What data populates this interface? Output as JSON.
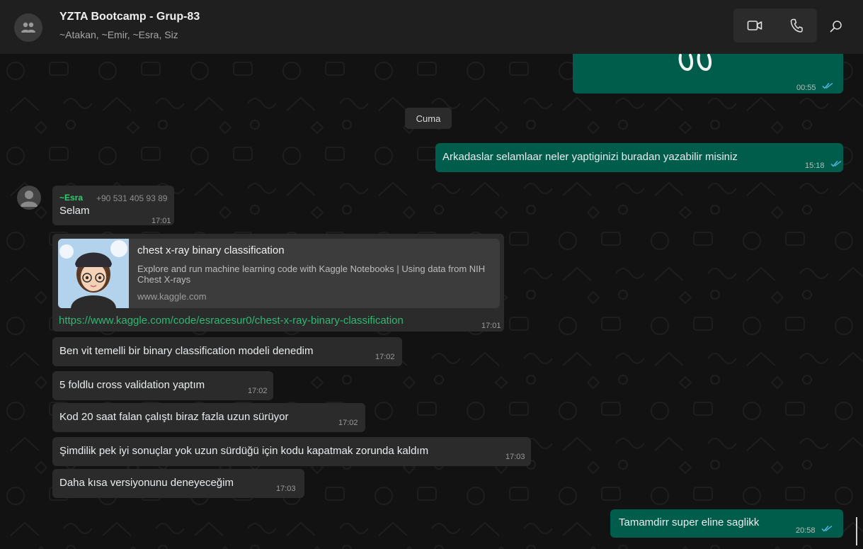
{
  "header": {
    "title": "YZTA Bootcamp - Grup-83",
    "members": "~Atakan, ~Emir, ~Esra, Siz"
  },
  "icons": {
    "group_avatar": "group-avatar-icon",
    "video": "video-call-icon",
    "phone": "voice-call-icon",
    "search": "search-icon",
    "read_receipt": "double-check-icon"
  },
  "colors": {
    "outgoing": "#005c4b",
    "incoming": "#2b2b2b",
    "sender_name": "#2ecc71",
    "link": "#2eb872",
    "read_tick": "#53bdeb"
  },
  "messages": {
    "m0": {
      "time": "00:55"
    },
    "date_separator": "Cuma",
    "m1": {
      "text": "Arkadaslar selamlaar neler yaptiginizi buradan yazabilir misiniz",
      "time": "15:18"
    },
    "m2": {
      "sender": "~Esra",
      "phone": "+90 531 405 93 89",
      "text": "Selam",
      "time": "17:01"
    },
    "m3": {
      "preview_title": "chest x-ray binary classification",
      "preview_description": "Explore and run machine learning code with Kaggle Notebooks | Using data from NIH Chest X-rays",
      "preview_domain": "www.kaggle.com",
      "link": "https://www.kaggle.com/code/esracesur0/chest-x-ray-binary-classification",
      "time": "17:01"
    },
    "m4": {
      "text": "Ben vit temelli bir binary classification modeli denedim",
      "time": "17:02"
    },
    "m5": {
      "text": "5 foldlu cross validation yaptım",
      "time": "17:02"
    },
    "m6": {
      "text": "Kod 20 saat falan çalıştı biraz fazla uzun sürüyor",
      "time": "17:02"
    },
    "m7": {
      "text": "Şimdilik pek iyi sonuçlar yok uzun sürdüğü için kodu kapatmak zorunda kaldım",
      "time": "17:03"
    },
    "m8": {
      "text": "Daha kısa versiyonunu deneyeceğim",
      "time": "17:03"
    },
    "m9": {
      "text": "Tamamdirr super eline saglikk",
      "time": "20:58"
    }
  }
}
